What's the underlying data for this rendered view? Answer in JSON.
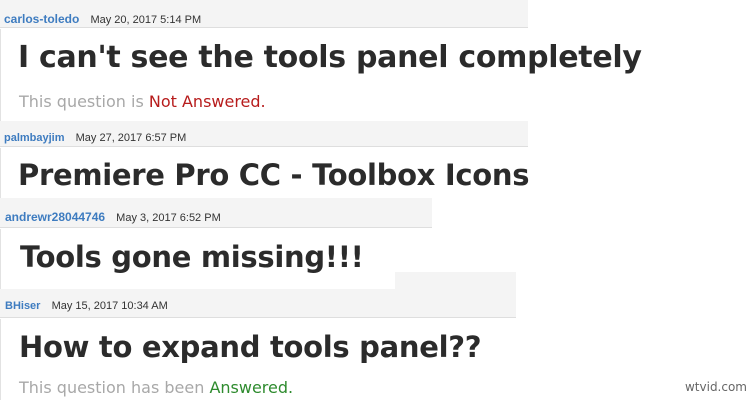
{
  "posts": [
    {
      "username": "carlos-toledo",
      "date": "May 20, 2017 5:14 PM",
      "title": "I can't see the tools panel completely",
      "status_prefix": "This question is ",
      "status_value": "Not Answered."
    },
    {
      "username": "palmbayjim",
      "date": "May 27, 2017 6:57 PM",
      "title": "Premiere Pro CC - Toolbox Icons"
    },
    {
      "username": "andrewr28044746",
      "date": "May 3, 2017 6:52 PM",
      "title": "Tools gone missing!!!"
    },
    {
      "username": "BHiser",
      "date": "May 15, 2017 10:34 AM",
      "title": "How to expand tools panel??",
      "status_prefix": "This question has been ",
      "status_value": "Answered."
    }
  ],
  "watermark": "wtvid.com",
  "colors": {
    "username": "#3e7cc0",
    "not_answered": "#b71c1c",
    "answered": "#2e8b2e",
    "meta_bg": "#f4f4f4"
  }
}
